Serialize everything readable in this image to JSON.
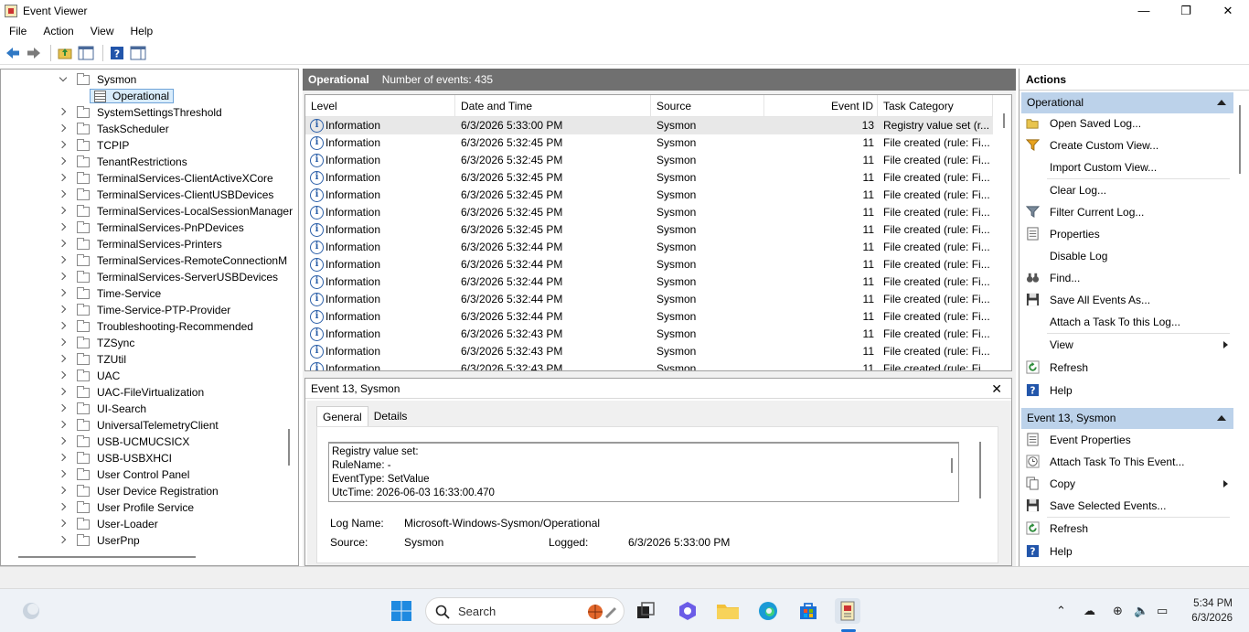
{
  "window": {
    "title": "Event Viewer",
    "minimize": "—",
    "maximize": "❐",
    "close": "✕"
  },
  "menu": [
    "File",
    "Action",
    "View",
    "Help"
  ],
  "tree": {
    "expanded": "Sysmon",
    "selected": "Operational",
    "items": [
      "SystemSettingsThreshold",
      "TaskScheduler",
      "TCPIP",
      "TenantRestrictions",
      "TerminalServices-ClientActiveXCore",
      "TerminalServices-ClientUSBDevices",
      "TerminalServices-LocalSessionManager",
      "TerminalServices-PnPDevices",
      "TerminalServices-Printers",
      "TerminalServices-RemoteConnectionM",
      "TerminalServices-ServerUSBDevices",
      "Time-Service",
      "Time-Service-PTP-Provider",
      "Troubleshooting-Recommended",
      "TZSync",
      "TZUtil",
      "UAC",
      "UAC-FileVirtualization",
      "UI-Search",
      "UniversalTelemetryClient",
      "USB-UCMUCSICX",
      "USB-USBXHCI",
      "User Control Panel",
      "User Device Registration",
      "User Profile Service",
      "User-Loader",
      "UserPnp"
    ]
  },
  "center": {
    "log_name": "Operational",
    "event_count": "Number of events: 435",
    "columns": [
      "Level",
      "Date and Time",
      "Source",
      "Event ID",
      "Task Category"
    ],
    "rows": [
      [
        "Information",
        "6/3/2026 5:33:00 PM",
        "Sysmon",
        "13",
        "Registry value set (r..."
      ],
      [
        "Information",
        "6/3/2026 5:32:45 PM",
        "Sysmon",
        "11",
        "File created (rule: Fi..."
      ],
      [
        "Information",
        "6/3/2026 5:32:45 PM",
        "Sysmon",
        "11",
        "File created (rule: Fi..."
      ],
      [
        "Information",
        "6/3/2026 5:32:45 PM",
        "Sysmon",
        "11",
        "File created (rule: Fi..."
      ],
      [
        "Information",
        "6/3/2026 5:32:45 PM",
        "Sysmon",
        "11",
        "File created (rule: Fi..."
      ],
      [
        "Information",
        "6/3/2026 5:32:45 PM",
        "Sysmon",
        "11",
        "File created (rule: Fi..."
      ],
      [
        "Information",
        "6/3/2026 5:32:45 PM",
        "Sysmon",
        "11",
        "File created (rule: Fi..."
      ],
      [
        "Information",
        "6/3/2026 5:32:44 PM",
        "Sysmon",
        "11",
        "File created (rule: Fi..."
      ],
      [
        "Information",
        "6/3/2026 5:32:44 PM",
        "Sysmon",
        "11",
        "File created (rule: Fi..."
      ],
      [
        "Information",
        "6/3/2026 5:32:44 PM",
        "Sysmon",
        "11",
        "File created (rule: Fi..."
      ],
      [
        "Information",
        "6/3/2026 5:32:44 PM",
        "Sysmon",
        "11",
        "File created (rule: Fi..."
      ],
      [
        "Information",
        "6/3/2026 5:32:44 PM",
        "Sysmon",
        "11",
        "File created (rule: Fi..."
      ],
      [
        "Information",
        "6/3/2026 5:32:43 PM",
        "Sysmon",
        "11",
        "File created (rule: Fi..."
      ],
      [
        "Information",
        "6/3/2026 5:32:43 PM",
        "Sysmon",
        "11",
        "File created (rule: Fi..."
      ],
      [
        "Information",
        "6/3/2026 5:32:43 PM",
        "Sysmon",
        "11",
        "File created (rule: Fi..."
      ]
    ]
  },
  "detail": {
    "title": "Event 13, Sysmon",
    "tabs": [
      "General",
      "Details"
    ],
    "message": [
      "Registry value set:",
      "RuleName: -",
      "EventType: SetValue",
      "UtcTime: 2026-06-03 16:33:00.470"
    ],
    "log_name_label": "Log Name:",
    "log_name_value": "Microsoft-Windows-Sysmon/Operational",
    "source_label": "Source:",
    "source_value": "Sysmon",
    "logged_label": "Logged:",
    "logged_value": "6/3/2026 5:33:00 PM"
  },
  "actions": {
    "title": "Actions",
    "section1": "Operational",
    "items1": [
      "Open Saved Log...",
      "Create Custom View...",
      "Import Custom View...",
      "Clear Log...",
      "Filter Current Log...",
      "Properties",
      "Disable Log",
      "Find...",
      "Save All Events As...",
      "Attach a Task To this Log...",
      "View",
      "Refresh",
      "Help"
    ],
    "section2": "Event 13, Sysmon",
    "items2": [
      "Event Properties",
      "Attach Task To This Event...",
      "Copy",
      "Save Selected Events...",
      "Refresh",
      "Help"
    ]
  },
  "taskbar": {
    "search": "Search",
    "time": "5:34 PM",
    "date": "6/3/2026"
  }
}
